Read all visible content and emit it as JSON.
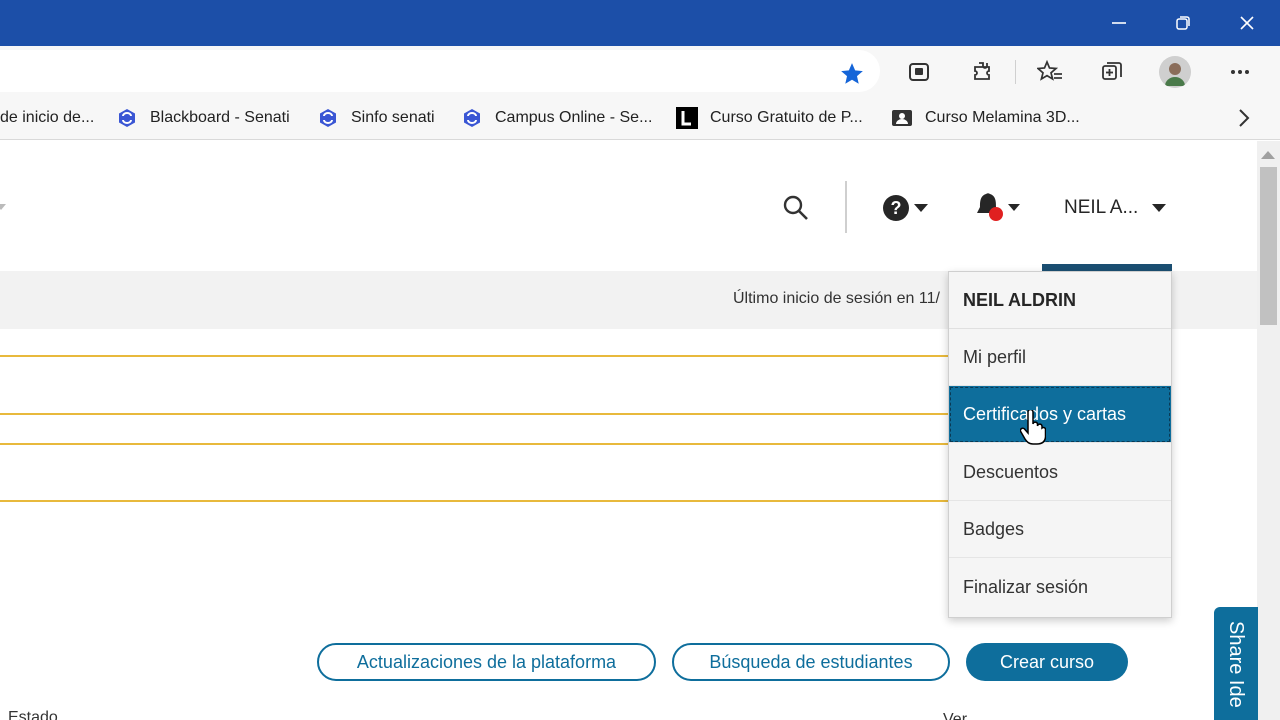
{
  "browser": {
    "window_controls": {
      "minimize": "—",
      "restore": "❐",
      "close": "✕"
    },
    "toolbar_icons": [
      "collections-badge-icon",
      "extensions-icon",
      "favorites-icon",
      "collections-icon",
      "profile-avatar",
      "more-icon"
    ],
    "favorites": [
      {
        "label": "de inicio de...",
        "icon": "none"
      },
      {
        "label": "Blackboard - Senati",
        "icon": "senati-logo-icon"
      },
      {
        "label": "Sinfo senati",
        "icon": "senati-logo-icon"
      },
      {
        "label": "Campus Online - Se...",
        "icon": "senati-logo-icon"
      },
      {
        "label": "Curso Gratuito de P...",
        "icon": "letter-l-icon"
      },
      {
        "label": "Curso Melamina 3D...",
        "icon": "contact-card-icon"
      }
    ],
    "colors": {
      "titlebar": "#1c4fa8",
      "star": "#1565d8"
    }
  },
  "header": {
    "user_short": "NEIL A...",
    "help_label": "?"
  },
  "last_login": "Último inicio de sesión en 11/",
  "user_menu": {
    "title": "NEIL ALDRIN",
    "items": [
      {
        "label": "Mi perfil",
        "active": false
      },
      {
        "label": "Certificados y cartas",
        "active": true
      },
      {
        "label": "Descuentos",
        "active": false
      },
      {
        "label": "Badges",
        "active": false
      },
      {
        "label": "Finalizar sesión",
        "active": false
      }
    ]
  },
  "actions": {
    "platform_updates": "Actualizaciones de la plataforma",
    "student_search": "Búsqueda de estudiantes",
    "create_course": "Crear curso"
  },
  "table": {
    "col_estado": "Estado",
    "col_ver": "Ver"
  },
  "share_ideas": "Share Ide",
  "colors": {
    "primary": "#0e6e9c",
    "accent_line": "#e8b93c",
    "notification_dot": "#e02020"
  }
}
